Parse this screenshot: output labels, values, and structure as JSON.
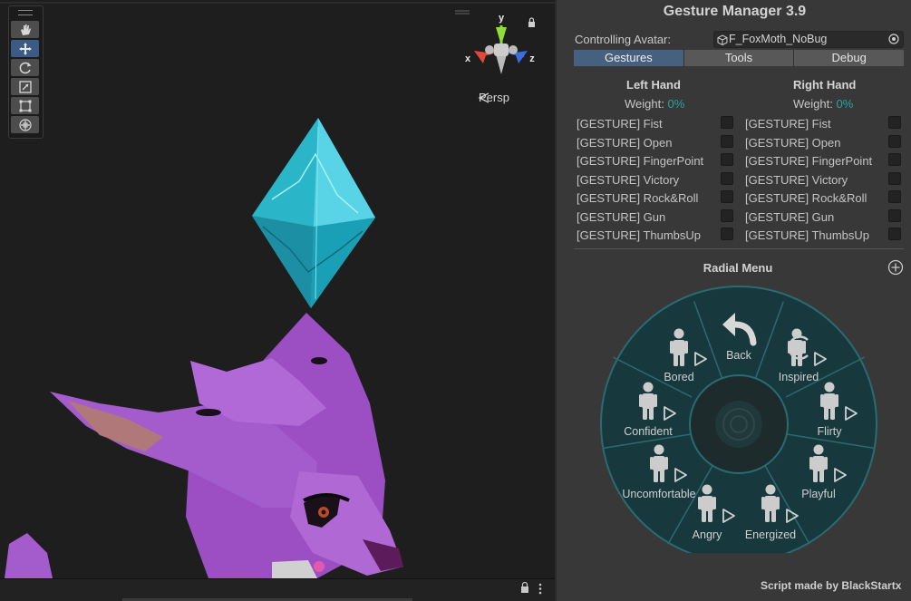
{
  "scene": {
    "view_mode": "Persp",
    "gizmo": {
      "y": "y",
      "x": "x",
      "z": "z"
    },
    "tools": [
      {
        "name": "hand-tool-icon"
      },
      {
        "name": "move-tool-icon"
      },
      {
        "name": "rotate-tool-icon"
      },
      {
        "name": "scale-tool-icon"
      },
      {
        "name": "rect-tool-icon"
      },
      {
        "name": "transform-tool-icon"
      }
    ]
  },
  "panel": {
    "title": "Gesture Manager 3.9",
    "avatar_label": "Controlling Avatar:",
    "avatar_value": "F_FoxMoth_NoBug",
    "tabs": [
      "Gestures",
      "Tools",
      "Debug"
    ],
    "left": {
      "title": "Left Hand",
      "weight_label": "Weight:",
      "weight_value": "0%"
    },
    "right": {
      "title": "Right Hand",
      "weight_label": "Weight:",
      "weight_value": "0%"
    },
    "gestures": [
      "[GESTURE] Fist",
      "[GESTURE] Open",
      "[GESTURE] FingerPoint",
      "[GESTURE] Victory",
      "[GESTURE] Rock&Roll",
      "[GESTURE] Gun",
      "[GESTURE] ThumbsUp"
    ],
    "radial_title": "Radial Menu",
    "radial_items": [
      "Back",
      "Inspired",
      "Flirty",
      "Playful",
      "Energized",
      "Angry",
      "Uncomfortable",
      "Confident",
      "Bored"
    ],
    "credit": "Script made by BlackStartx",
    "colors": {
      "accent": "#2aa39e",
      "tab_active": "#46607f",
      "radial_bg": "#17393d"
    }
  }
}
